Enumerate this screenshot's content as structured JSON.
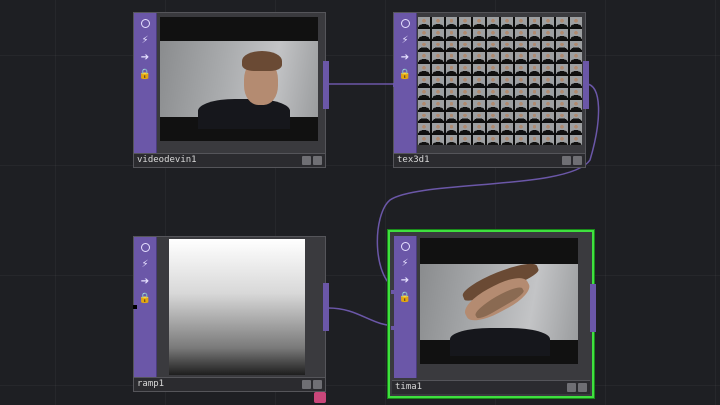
{
  "nodes": {
    "videodevin": {
      "name": "videodevin1"
    },
    "tex3d": {
      "name": "tex3d1"
    },
    "ramp": {
      "name": "ramp1"
    },
    "time": {
      "name": "tima1"
    }
  },
  "sidebar_icons": [
    "render-icon",
    "bolt-icon",
    "arrow-right-icon",
    "lock-icon"
  ],
  "colors": {
    "background": "#1e1f23",
    "node_sidebar": "#6b57a8",
    "wire": "#6b57a8",
    "selected_outline": "#3fe03f"
  }
}
